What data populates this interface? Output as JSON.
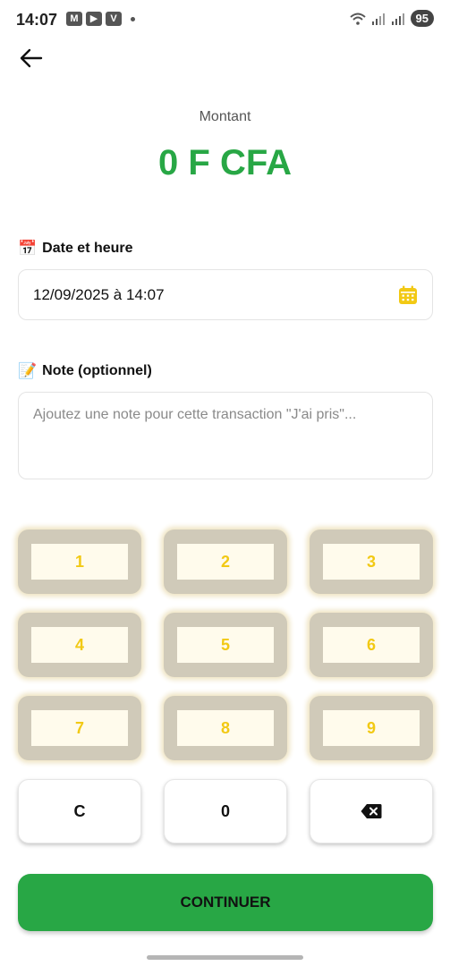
{
  "status_bar": {
    "time": "14:07",
    "app_icons": [
      "M",
      "▶",
      "V"
    ],
    "battery": "95"
  },
  "amount": {
    "label": "Montant",
    "value": "0 F CFA",
    "value_color": "#28a745"
  },
  "date": {
    "emoji": "📅",
    "label": "Date et heure",
    "value": "12/09/2025 à 14:07",
    "icon": "calendar-icon",
    "icon_color": "#f2c914"
  },
  "note": {
    "emoji": "📝",
    "label": "Note (optionnel)",
    "value": "",
    "placeholder": "Ajoutez une note pour cette transaction \"J'ai pris\"..."
  },
  "keypad": {
    "digits": [
      "1",
      "2",
      "3",
      "4",
      "5",
      "6",
      "7",
      "8",
      "9"
    ],
    "clear": "C",
    "zero": "0",
    "backspace_icon": "backspace-icon",
    "digit_color": "#f2c914"
  },
  "continue_label": "CONTINUER",
  "accent_color": "#28a745"
}
